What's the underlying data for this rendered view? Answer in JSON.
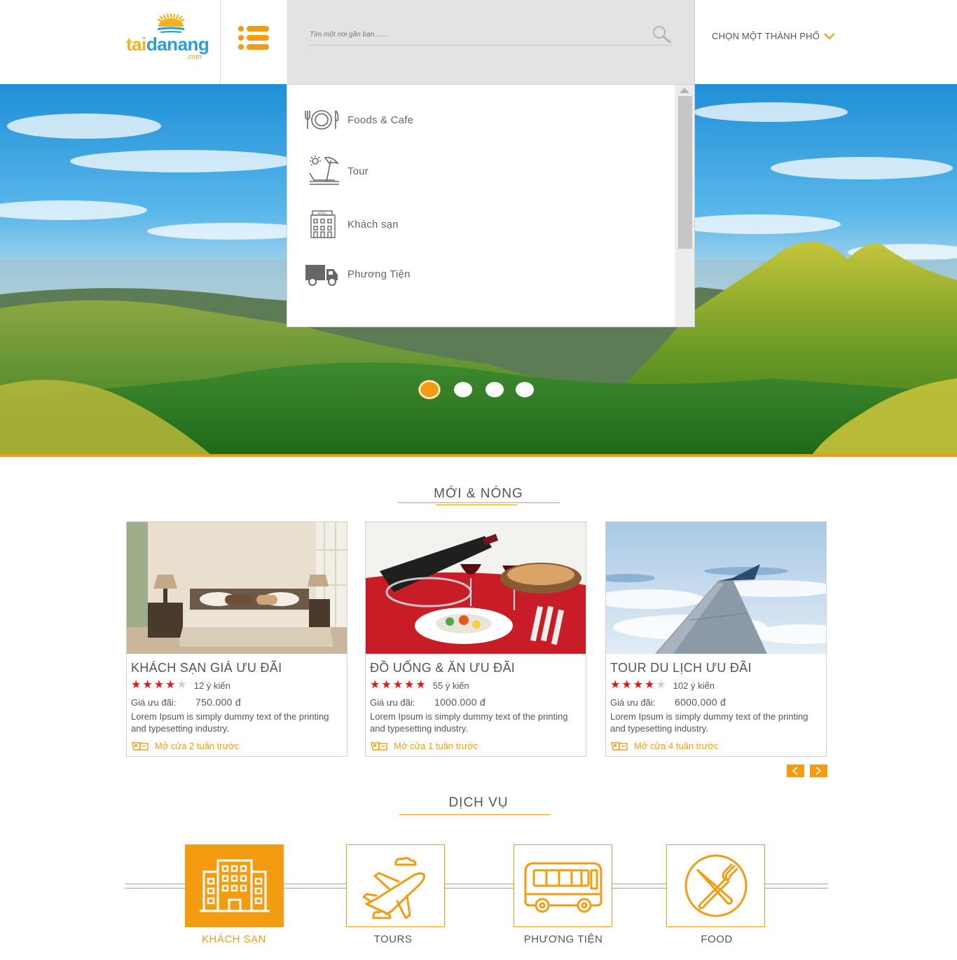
{
  "brand": {
    "logo_tai": "tai",
    "logo_danang": "danang",
    "logo_com": ".com"
  },
  "search": {
    "placeholder": "Tìm một nơi gần bạn......."
  },
  "city_select": {
    "label": "CHỌN MỘT THÀNH PHỐ"
  },
  "categories": [
    {
      "label": "Foods & Cafe",
      "icon": "plate-fork-knife-icon"
    },
    {
      "label": "Tour",
      "icon": "beach-chair-icon"
    },
    {
      "label": "Khách sạn",
      "icon": "hotel-icon"
    },
    {
      "label": "Phương Tiện",
      "icon": "truck-icon"
    }
  ],
  "slider": {
    "count": 4,
    "active_index": 0
  },
  "new_hot": {
    "title": "MỚI & NÓNG",
    "cards": [
      {
        "title": "KHÁCH SẠN GIÁ ƯU ĐÃI",
        "stars": 4,
        "max_stars": 5,
        "reviews": "12 ý kiến",
        "price_label": "Giá  ưu đãi:",
        "price": "750.000 đ",
        "description": "Lorem Ipsum is simply dummy text of the printing and typesetting industry.",
        "opened": "Mở cửa 2 tuần trước"
      },
      {
        "title": "ĐỒ UỐNG & ĂN ƯU ĐÃI",
        "stars": 5,
        "max_stars": 5,
        "reviews": "55 ý kiến",
        "price_label": "Giá  ưu đãi:",
        "price": "1000.000 đ",
        "description": "Lorem Ipsum is simply dummy text of the printing and typesetting industry.",
        "opened": "Mở cửa 1 tuần trước"
      },
      {
        "title": "TOUR DU LỊCH ƯU ĐÃI",
        "stars": 4,
        "max_stars": 5,
        "reviews": "102 ý kiến",
        "price_label": "Giá  ưu đãi:",
        "price": "6000.000 đ",
        "description": "Lorem Ipsum is simply dummy text of the printing and typesetting industry.",
        "opened": "Mở cửa 4 tuần trước"
      }
    ]
  },
  "services": {
    "title": "DỊCH VỤ",
    "items": [
      {
        "label": "KHÁCH SẠN",
        "icon": "hotel-building-icon",
        "active": true
      },
      {
        "label": "TOURS",
        "icon": "airplane-icon",
        "active": false
      },
      {
        "label": "PHƯƠNG TIỆN",
        "icon": "bus-icon",
        "active": false
      },
      {
        "label": "FOOD",
        "icon": "fork-knife-icon",
        "active": false
      }
    ]
  },
  "colors": {
    "accent": "#f39c12",
    "star": "#e8141b",
    "search_bg": "#e3e3e3"
  }
}
